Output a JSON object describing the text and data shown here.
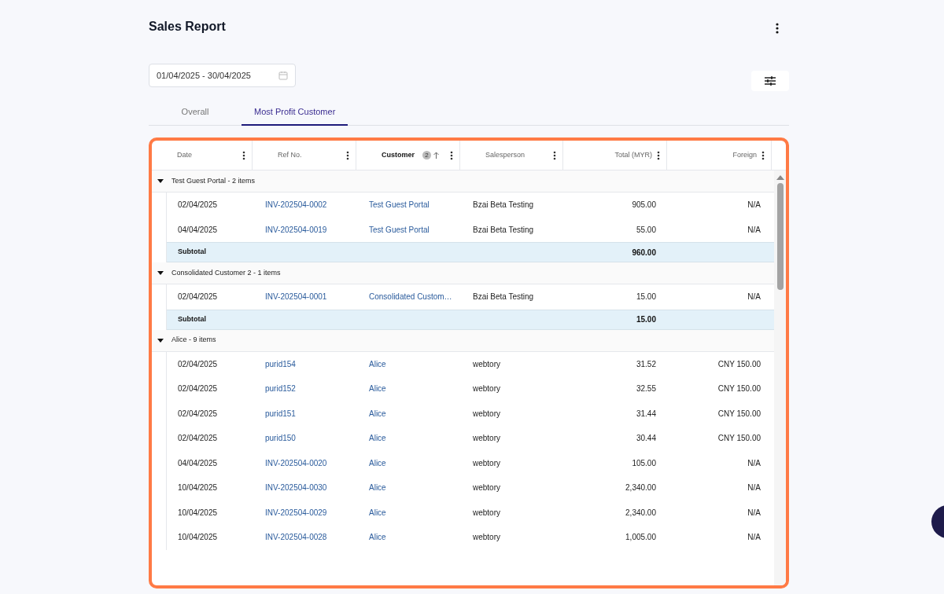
{
  "page": {
    "title": "Sales Report"
  },
  "date_range": {
    "value": "01/04/2025 - 30/04/2025"
  },
  "tabs": [
    {
      "label": "Overall",
      "selected": false
    },
    {
      "label": "Most Profit Customer",
      "selected": true
    }
  ],
  "table": {
    "columns": [
      {
        "label": "Date",
        "sorted": false
      },
      {
        "label": "Ref No.",
        "sorted": false
      },
      {
        "label": "Customer",
        "sorted": true,
        "sort_index": "2"
      },
      {
        "label": "Salesperson",
        "sorted": false
      },
      {
        "label": "Total (MYR)",
        "sorted": false
      },
      {
        "label": "Foreign",
        "sorted": false
      }
    ],
    "groups": [
      {
        "label": "Test Guest Portal - 2 items",
        "expanded": true,
        "rows": [
          [
            "02/04/2025",
            "INV-202504-0002",
            "Test Guest Portal",
            "Bzai Beta Testing",
            "905.00",
            "N/A"
          ],
          [
            "04/04/2025",
            "INV-202504-0019",
            "Test Guest Portal",
            "Bzai Beta Testing",
            "55.00",
            "N/A"
          ]
        ],
        "subtotal": {
          "label": "Subtotal",
          "total": "960.00"
        }
      },
      {
        "label": "Consolidated Customer 2 - 1 items",
        "expanded": true,
        "rows": [
          [
            "02/04/2025",
            "INV-202504-0001",
            "Consolidated Custom…",
            "Bzai Beta Testing",
            "15.00",
            "N/A"
          ]
        ],
        "subtotal": {
          "label": "Subtotal",
          "total": "15.00"
        }
      },
      {
        "label": "Alice - 9 items",
        "expanded": true,
        "rows": [
          [
            "02/04/2025",
            "purid154",
            "Alice",
            "webtory",
            "31.52",
            "CNY 150.00"
          ],
          [
            "02/04/2025",
            "purid152",
            "Alice",
            "webtory",
            "32.55",
            "CNY 150.00"
          ],
          [
            "02/04/2025",
            "purid151",
            "Alice",
            "webtory",
            "31.44",
            "CNY 150.00"
          ],
          [
            "02/04/2025",
            "purid150",
            "Alice",
            "webtory",
            "30.44",
            "CNY 150.00"
          ],
          [
            "04/04/2025",
            "INV-202504-0020",
            "Alice",
            "webtory",
            "105.00",
            "N/A"
          ],
          [
            "10/04/2025",
            "INV-202504-0030",
            "Alice",
            "webtory",
            "2,340.00",
            "N/A"
          ],
          [
            "10/04/2025",
            "INV-202504-0029",
            "Alice",
            "webtory",
            "2,340.00",
            "N/A"
          ],
          [
            "10/04/2025",
            "INV-202504-0028",
            "Alice",
            "webtory",
            "1,005.00",
            "N/A"
          ]
        ]
      }
    ]
  }
}
